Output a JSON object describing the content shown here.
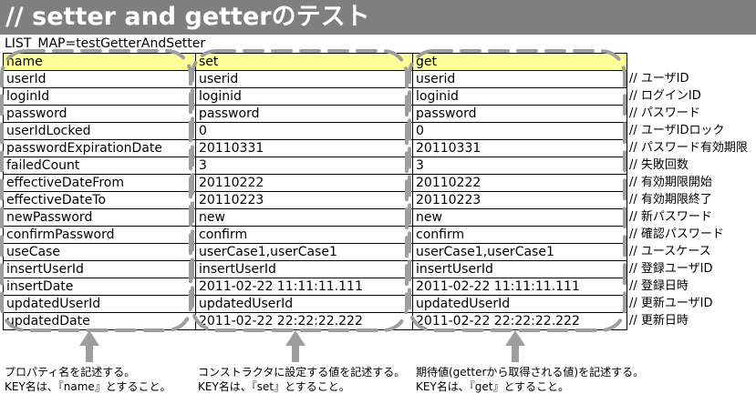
{
  "title": "// setter and getterのテスト",
  "list_map": "LIST_MAP=testGetterAndSetter",
  "table": {
    "headers": [
      "name",
      "set",
      "get"
    ],
    "rows": [
      [
        "userId",
        "userid",
        "userid"
      ],
      [
        "loginId",
        "loginid",
        "loginid"
      ],
      [
        "password",
        "password",
        "password"
      ],
      [
        "userIdLocked",
        "0",
        "0"
      ],
      [
        "passwordExpirationDate",
        "20110331",
        "20110331"
      ],
      [
        "failedCount",
        "3",
        "3"
      ],
      [
        "effectiveDateFrom",
        "20110222",
        "20110222"
      ],
      [
        "effectiveDateTo",
        "20110223",
        "20110223"
      ],
      [
        "newPassword",
        "new",
        "new"
      ],
      [
        "confirmPassword",
        "confirm",
        "confirm"
      ],
      [
        "useCase",
        "userCase1,userCase1",
        "userCase1,userCase1"
      ],
      [
        "insertUserId",
        "insertUserId",
        "insertUserId"
      ],
      [
        "insertDate",
        "2011-02-22 11:11:11.111",
        "2011-02-22 11:11:11.111"
      ],
      [
        "updatedUserId",
        "updatedUserId",
        "updatedUserId"
      ],
      [
        "updatedDate",
        "2011-02-22 22:22:22.222",
        "2011-02-22 22:22:22.222"
      ]
    ]
  },
  "comments": [
    "// ユーザID",
    "// ログインID",
    "// パスワード",
    "// ユーザIDロック",
    "// パスワード有効期限",
    "// 失敗回数",
    "// 有効期限開始",
    "// 有効期限終了",
    "// 新パスワード",
    "// 確認パスワード",
    "// ユースケース",
    "// 登録ユーザID",
    "// 登録日時",
    "// 更新ユーザID",
    "// 更新日時"
  ],
  "notes": {
    "name": [
      "プロパティ名を記述する。",
      "KEY名は、『name』とすること。"
    ],
    "set": [
      "コンストラクタに設定する値を記述する。",
      "KEY名は、『set』とすること。"
    ],
    "get": [
      "期待値(getterから取得される値)を記述する。",
      "KEY名は、『get』とすること。"
    ]
  },
  "colors": {
    "title_bar": "#7f7f7f",
    "header_fill": "#ffff99",
    "annotation": "#9e9e9e"
  }
}
